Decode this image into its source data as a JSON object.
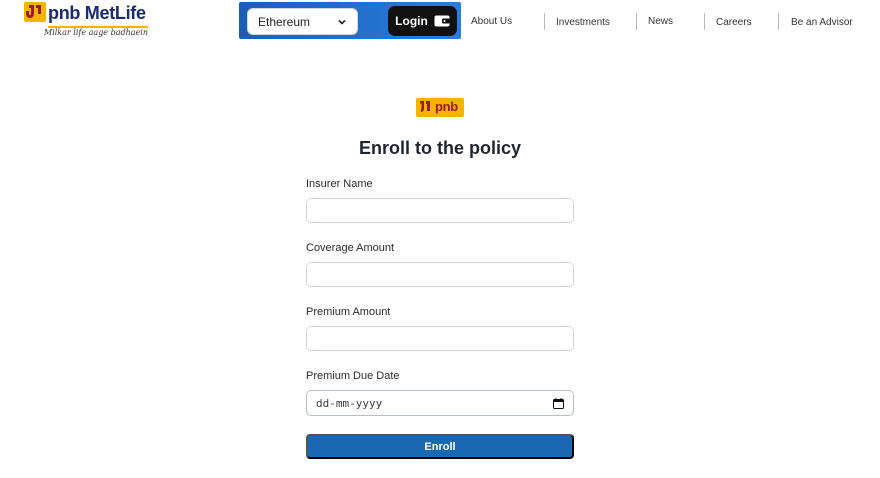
{
  "brand": {
    "name": "pnb MetLife",
    "tagline": "Milkar life aage badhaein",
    "form_logo_text": "pnb"
  },
  "wallet": {
    "network_selected": "Ethereum",
    "login_label": "Login"
  },
  "nav": {
    "items": [
      {
        "label": "About Us"
      },
      {
        "label": "Investments"
      },
      {
        "label": "News"
      },
      {
        "label": "Careers"
      },
      {
        "label": "Be an Advisor"
      }
    ]
  },
  "form": {
    "title": "Enroll to the policy",
    "fields": [
      {
        "label": "Insurer Name",
        "value": "",
        "placeholder": ""
      },
      {
        "label": "Coverage Amount",
        "value": "",
        "placeholder": ""
      },
      {
        "label": "Premium Amount",
        "value": "",
        "placeholder": ""
      },
      {
        "label": "Premium Due Date",
        "value": "",
        "placeholder": "dd-mm-yyyy"
      }
    ],
    "submit_label": "Enroll"
  },
  "colors": {
    "wallet_bar": "#1a5fb4",
    "login_button": "#111111",
    "enroll_button": "#1a68b3",
    "brand_yellow": "#f5b400",
    "brand_red": "#9b1b30"
  },
  "icons": {
    "network_dropdown": "chevron-down-icon",
    "login": "wallet-icon",
    "date": "calendar-icon"
  }
}
